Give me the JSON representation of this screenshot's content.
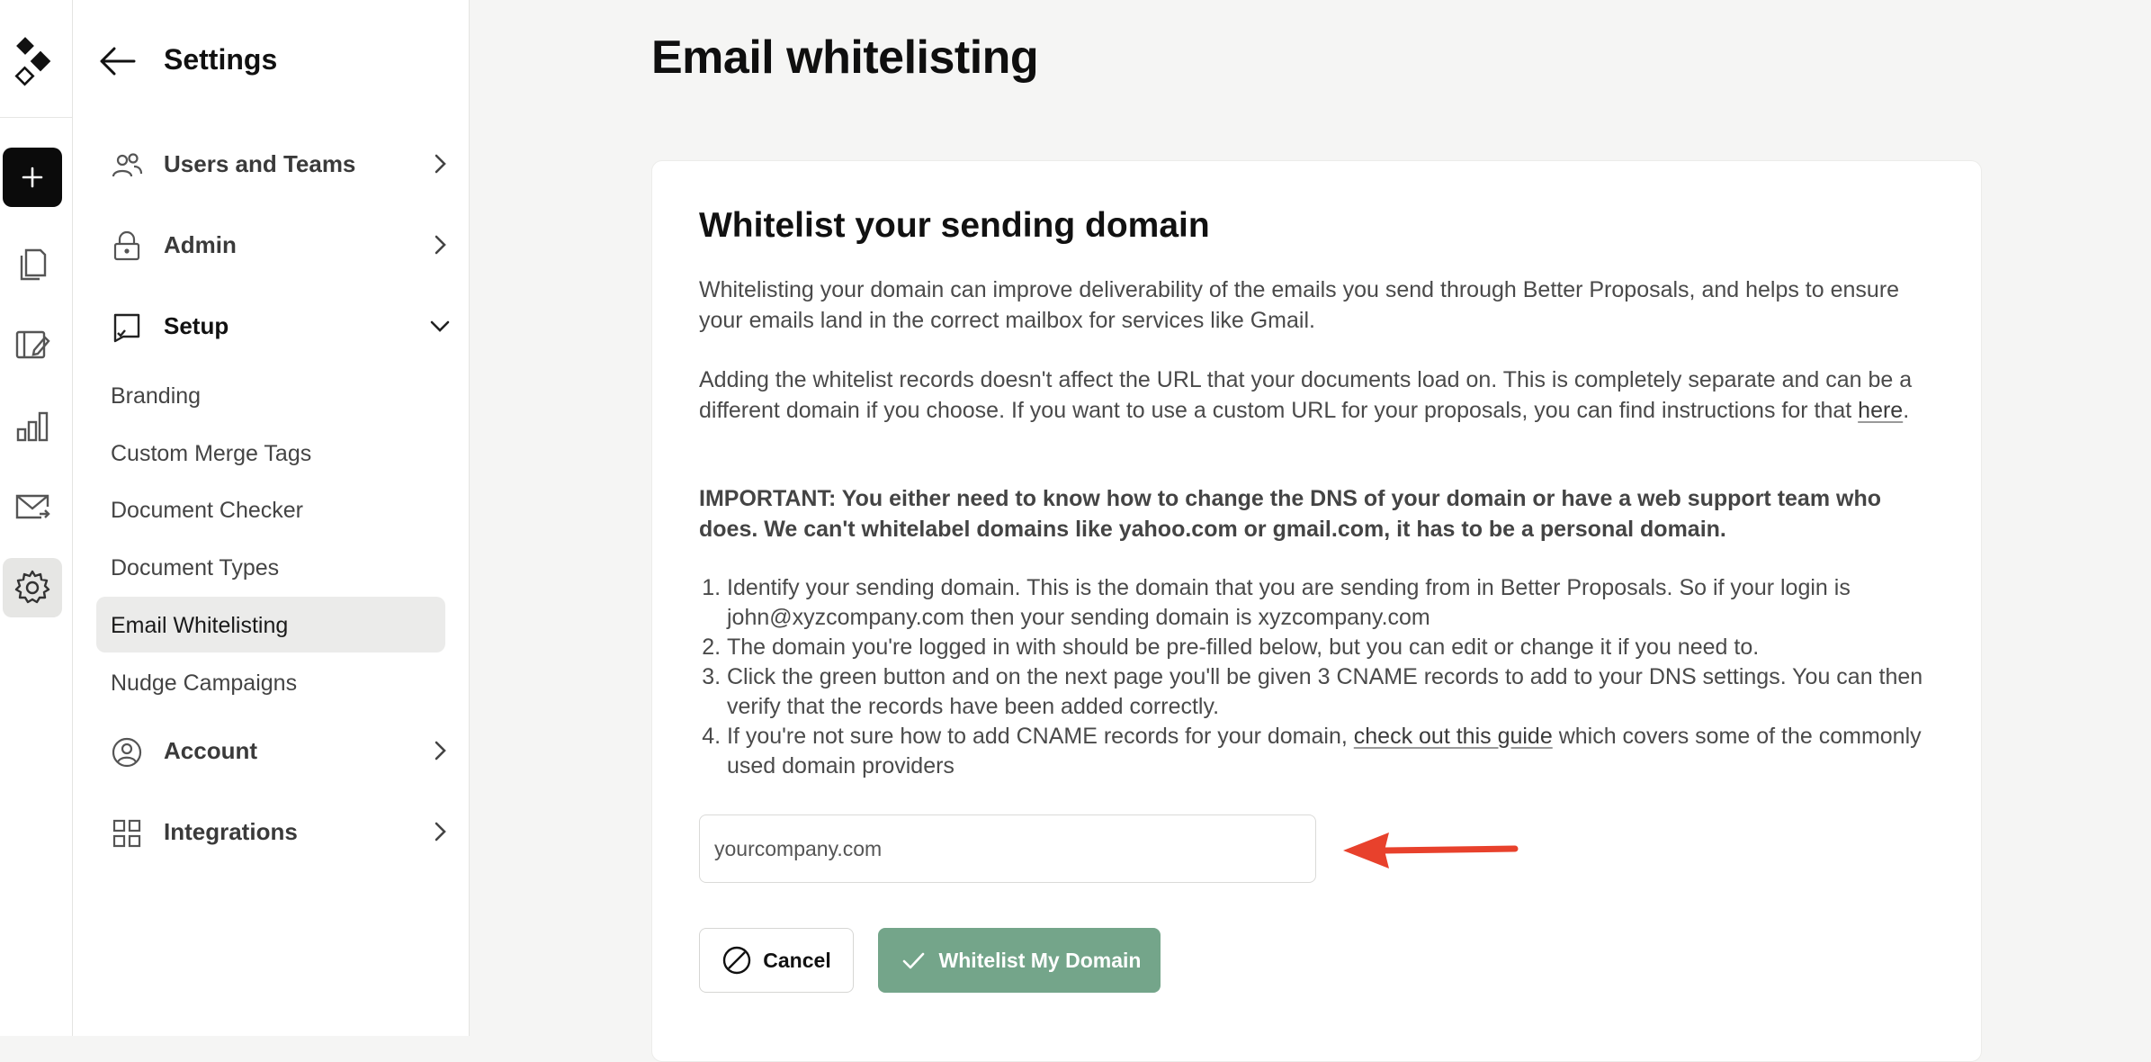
{
  "sidebar": {
    "title": "Settings",
    "items": [
      {
        "label": "Users and Teams",
        "icon": "users-icon"
      },
      {
        "label": "Admin",
        "icon": "lock-icon"
      },
      {
        "label": "Setup",
        "icon": "setup-icon"
      },
      {
        "label": "Account",
        "icon": "account-icon"
      },
      {
        "label": "Integrations",
        "icon": "grid-icon"
      }
    ],
    "setup_subitems": [
      "Branding",
      "Custom Merge Tags",
      "Document Checker",
      "Document Types",
      "Email Whitelisting",
      "Nudge Campaigns"
    ],
    "active_subitem": "Email Whitelisting"
  },
  "rail": {
    "icons": [
      "logo-icon",
      "plus-icon",
      "documents-icon",
      "templates-icon",
      "reports-icon",
      "mail-icon",
      "settings-gear-icon"
    ]
  },
  "main": {
    "title": "Email whitelisting",
    "card": {
      "heading": "Whitelist your sending domain",
      "intro": "Whitelisting your domain can improve deliverability of the emails you send through Better Proposals, and helps to ensure your emails land in the correct mailbox for services like Gmail.",
      "url_note": "Adding the whitelist records doesn't affect the URL that your documents load on. This is completely separate and can be a different domain if you choose. If you want to use a custom URL for your proposals, you can find instructions for that ",
      "url_note_link": "here",
      "url_note_end": ".",
      "important": "IMPORTANT: You either need to know how to change the DNS of your domain or have a web support team who does. We can't whitelabel domains like yahoo.com or gmail.com, it has to be a personal domain.",
      "steps": [
        "Identify your sending domain. This is the domain that you are sending from in Better Proposals. So if your login is john@xyzcompany.com then your sending domain is xyzcompany.com",
        "The domain you're logged in with should be pre-filled below, but you can edit or change it if you need to.",
        "Click the green button and on the next page you'll be given 3 CNAME records to add to your DNS settings. You can then verify that the records have been added correctly."
      ],
      "step4_before": "If you're not sure how to add CNAME records for your domain, ",
      "step4_link": "check out this guide",
      "step4_after": " which covers some of the commonly used domain providers",
      "domain_placeholder": "yourcompany.com",
      "cancel_label": "Cancel",
      "submit_label": "Whitelist My Domain"
    }
  },
  "colors": {
    "primary_button": "#74a58a",
    "annotation_arrow": "#e8412c",
    "active_subitem_bg": "#ebebea"
  }
}
